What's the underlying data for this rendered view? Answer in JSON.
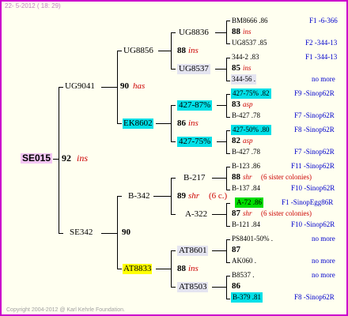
{
  "header": "22-  5-2012 ( 18: 29)",
  "copyright": "Copyright 2004-2012 @ Karl Kehrle Foundation.",
  "root": {
    "id": "SE015",
    "year": "92",
    "tag": "ins"
  },
  "gen1": {
    "father": {
      "id": "UG9041"
    },
    "mother": {
      "id": "SE342",
      "year": "90"
    }
  },
  "gen2": {
    "ff": {
      "id": "UG8856"
    },
    "fm": {
      "id": "EK8602"
    },
    "mf": {
      "id": "B-342"
    },
    "mm": {
      "id": "AT8833"
    },
    "f_year": "90",
    "f_tag": "has"
  },
  "gen3": {
    "a": {
      "id": "UG8836",
      "year": "88",
      "tag": "ins"
    },
    "b": {
      "id": "UG8537"
    },
    "c": {
      "id": "427-87%",
      "year": "86",
      "tag": "ins"
    },
    "d": {
      "id": "427-75%"
    },
    "e": {
      "id": "B-217",
      "year": "89",
      "tag": "shr",
      "extra": "(6 c.)"
    },
    "f": {
      "id": "A-322"
    },
    "g": {
      "id": "AT8601",
      "year": "88",
      "tag": "ins"
    },
    "h": {
      "id": "AT8503"
    }
  },
  "gen4": [
    {
      "top": "BM8666 .86",
      "top_right": "F1 -6-366",
      "mid_year": "88",
      "mid_tag": "ins",
      "bottom": "UG8537 .85",
      "bottom_right": "F2 -344-13"
    },
    {
      "top": "344-2 .83",
      "top_right": "F1 -344-13",
      "mid_year": "85",
      "mid_tag": "ins",
      "bottom": "344-56 .",
      "bottom_right": "no more"
    },
    {
      "top": "427-75% .82",
      "top_right": "F9 -Sinop62R",
      "mid_year": "83",
      "mid_tag": "asp",
      "bottom": "B-427 .78",
      "bottom_right": "F7 -Sinop62R"
    },
    {
      "top": "427-50% .80",
      "top_right": "F8 -Sinop62R",
      "mid_year": "82",
      "mid_tag": "asp",
      "bottom": "B-427 .78",
      "bottom_right": "F7 -Sinop62R"
    },
    {
      "top": "B-123 .86",
      "top_right": "F11 -Sinop62R",
      "mid_year": "88",
      "mid_tag": "shr",
      "mid_note": "(6 sister colonies)",
      "bottom": "B-137 .84",
      "bottom_right": "F10 -Sinop62R"
    },
    {
      "top": "A-72 .86",
      "top_right": "F1 -SinopEgg86R",
      "mid_year": "87",
      "mid_tag": "shr",
      "mid_note": "(6 sister colonies)",
      "bottom": "B-121 .84",
      "bottom_right": "F10 -Sinop62R"
    },
    {
      "top": "PS8401-50% .",
      "top_right": "no more",
      "mid_year": "87",
      "mid_tag": "",
      "bottom": "AK060 .",
      "bottom_right": "no more"
    },
    {
      "top": "B8537 .",
      "top_right": "no more",
      "mid_year": "86",
      "mid_tag": "",
      "bottom": "B-379 .81",
      "bottom_right": "F8 -Sinop62R"
    }
  ]
}
